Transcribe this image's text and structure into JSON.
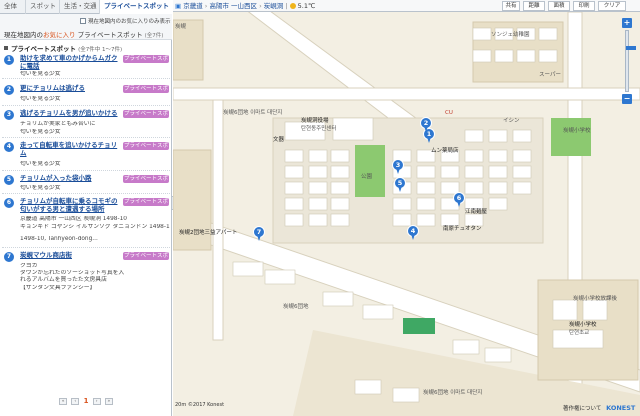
{
  "tabs": [
    "全体",
    "スポット",
    "生活・交通",
    "プライベートスポット"
  ],
  "subhead": {
    "favorites_check": "現在地図内のお気に入りのみ表示",
    "crumb_prefix": "現在地図内の",
    "crumb_highlight": "お気に入り",
    "crumb_section": "プライベートスポット",
    "crumb_count": "(全7件)"
  },
  "list": {
    "title": "プライベートスポット",
    "count": "(全7件中 1〜7件)",
    "items": [
      {
        "num": "1",
        "title": "助けを求めて車のかげからムガクに電話",
        "tag": "プライベートスポット",
        "sub": [
          "匂いを見る少女"
        ]
      },
      {
        "num": "2",
        "title": "更にチョリムは逃げる",
        "tag": "プライベートスポット",
        "sub": [
          "匂いを見る少女"
        ]
      },
      {
        "num": "3",
        "title": "逃げるチョリムを男が追いかける",
        "tag": "プライベートスポット",
        "sub": [
          "チョリムが実家ともみ合いに",
          "匂いを見る少女"
        ]
      },
      {
        "num": "4",
        "title": "走って自転車を追いかけるチョリム",
        "tag": "プライベートスポット",
        "sub": [
          "匂いを見る少女"
        ]
      },
      {
        "num": "5",
        "title": "チョリムが入った袋小路",
        "tag": "プライベートスポット",
        "sub": [
          "匂いを見る少女"
        ]
      },
      {
        "num": "6",
        "title": "チョリムが自転車に乗るコモギの匂いがする男と遭遇する場所",
        "tag": "プライベートスポット",
        "sub": [
          "京畿道 高陽市 一山西区 炭峴洞 1498-10",
          "キョンギド コヤンシ イルサンソグ タニョンドン 1498-10",
          "1498-10, Tanhyeon-dong..."
        ]
      },
      {
        "num": "7",
        "title": "炭峴マウル商店街",
        "tag": "プライベートスポット",
        "sub": [
          "クヨカ",
          "ダウンが忘れたのソーショット写真を入れるアルバムを買ったた文房具店",
          "【サンタン文具ファンシー】"
        ]
      }
    ]
  },
  "pager": {
    "first": "«",
    "prev": "‹",
    "current": "1",
    "next": "›",
    "last": "»"
  },
  "map": {
    "breadcrumb": [
      "京畿道",
      "高陽市 一山西区",
      "炭峴洞"
    ],
    "weather": "5.1℃",
    "tools": [
      "共有",
      "距離",
      "面積",
      "印刷",
      "クリア"
    ],
    "zoom_in": "+",
    "zoom_out": "−",
    "labels": {
      "ml1": "ソンジェ幼稚園",
      "ml2": "スーパー",
      "ml3": "炭峴洞役場",
      "ml4": "탄현동주민센터",
      "ml5": "文器",
      "ml6": "ムン薬局店",
      "ml7": "江南麺屋",
      "ml8": "イシン",
      "ml9": "炭峴小学校",
      "ml10": "炭峴2団地三益アパート",
      "ml11": "炭峴6団地",
      "ml12": "炭峴小学校放課後",
      "ml13": "炭峴小学校",
      "ml14": "탄현초교",
      "ml15": "南原チュオタン",
      "ml16": "公園",
      "ml17": "炭峴6団地 이마트 대단지",
      "ml18": "炭峴6団地 이마트 대단지",
      "ml19": "炭峴",
      "ml20": "CU"
    },
    "pins": [
      "1",
      "2",
      "3",
      "4",
      "5",
      "6",
      "7"
    ],
    "scale": "20m",
    "copyright": "©2017 Konest",
    "footer_link": "著作権について",
    "brand": "KONEST"
  },
  "colors": {
    "accent": "#2e77d0",
    "tag": "#c77ac9",
    "highlight": "#d9521c",
    "park": "#8cc970",
    "map_bg": "#f3efe3"
  }
}
